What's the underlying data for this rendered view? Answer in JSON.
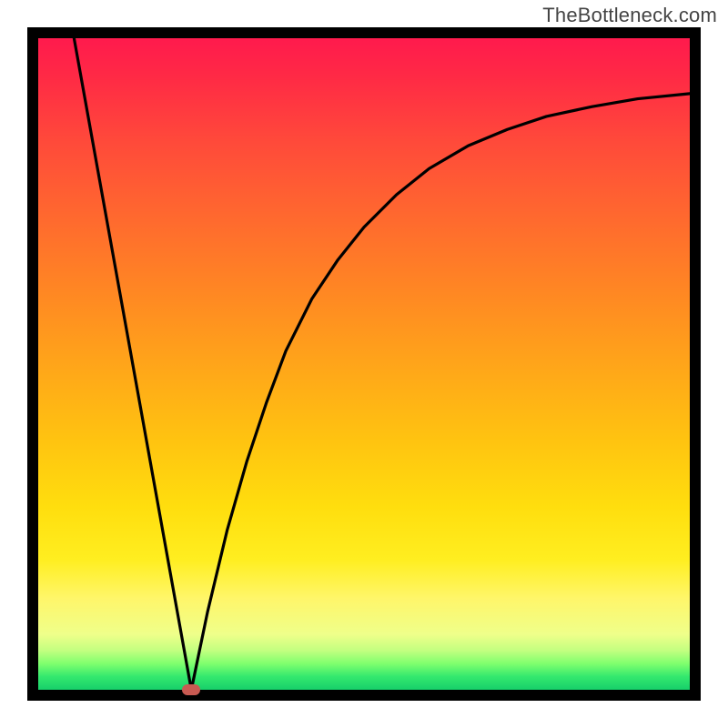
{
  "watermark": "TheBottleneck.com",
  "chart_data": {
    "type": "line",
    "title": "",
    "xlabel": "",
    "ylabel": "",
    "xlim": [
      0,
      1
    ],
    "ylim": [
      0,
      1
    ],
    "grid": false,
    "legend": false,
    "marker": {
      "x": 0.235,
      "y": 0.0,
      "color": "#c85a52"
    },
    "series": [
      {
        "name": "left-branch",
        "x": [
          0.055,
          0.235
        ],
        "y": [
          1.0,
          0.0
        ]
      },
      {
        "name": "right-branch",
        "x": [
          0.235,
          0.26,
          0.29,
          0.32,
          0.35,
          0.38,
          0.42,
          0.46,
          0.5,
          0.55,
          0.6,
          0.66,
          0.72,
          0.78,
          0.85,
          0.92,
          1.0
        ],
        "y": [
          0.0,
          0.12,
          0.245,
          0.35,
          0.44,
          0.52,
          0.6,
          0.66,
          0.71,
          0.76,
          0.8,
          0.835,
          0.86,
          0.88,
          0.895,
          0.907,
          0.915
        ]
      }
    ],
    "gradient_stops": [
      {
        "pos": 0.0,
        "color": "#ff1a4d"
      },
      {
        "pos": 0.4,
        "color": "#ff8a22"
      },
      {
        "pos": 0.8,
        "color": "#ffee20"
      },
      {
        "pos": 0.96,
        "color": "#7fff6e"
      },
      {
        "pos": 1.0,
        "color": "#17cf6a"
      }
    ]
  }
}
